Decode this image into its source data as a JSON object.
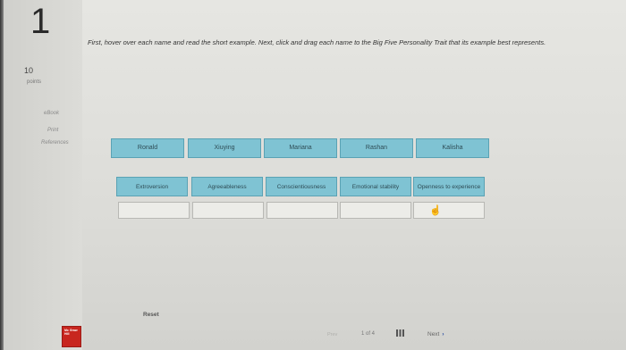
{
  "question": {
    "number": "1",
    "points_value": "10",
    "points_label": "points"
  },
  "sidebar": {
    "links": [
      {
        "label": "eBook"
      },
      {
        "label": "Print"
      },
      {
        "label": "References"
      }
    ]
  },
  "instructions": "First, hover over each name and read the short example. Next, click and drag each name to the Big Five Personality Trait that its example best represents.",
  "names": [
    {
      "label": "Ronald"
    },
    {
      "label": "Xiuying"
    },
    {
      "label": "Mariana"
    },
    {
      "label": "Rashan"
    },
    {
      "label": "Kalisha"
    }
  ],
  "traits": [
    {
      "label": "Extroversion"
    },
    {
      "label": "Agreeableness"
    },
    {
      "label": "Conscientiousness"
    },
    {
      "label": "Emotional stability"
    },
    {
      "label": "Openness to experience"
    }
  ],
  "controls": {
    "reset_label": "Reset"
  },
  "footer": {
    "logo_text": "Mc Graw Hill",
    "prev_label": "Prev",
    "page_indicator": "1 of 4",
    "next_label": "Next",
    "next_arrow": "›"
  },
  "colors": {
    "tile_fill": "#7fc3d3",
    "tile_border": "#5aa2b4",
    "logo_red": "#c8261f",
    "next_arrow": "#2b4fa3"
  }
}
